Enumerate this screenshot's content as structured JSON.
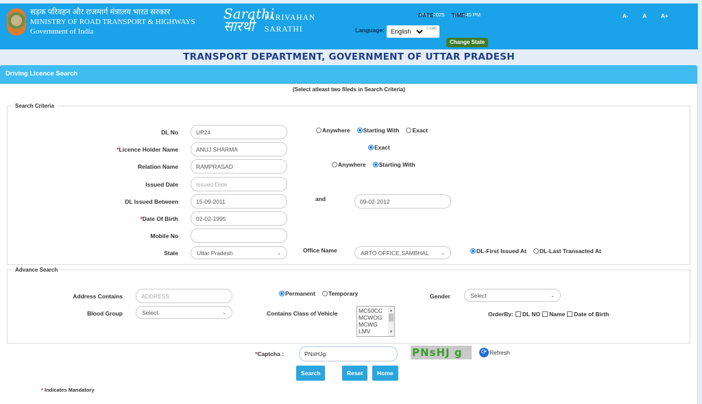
{
  "header": {
    "ministry_hindi": "सड़क परिवहन और राजमार्ग मंत्रालय भारत सरकार",
    "ministry_english": "MINISTRY OF ROAD TRANSPORT & HIGHWAYS",
    "government": "Government of India",
    "logo_top": "Sarathi",
    "logo_bottom": "सारथी",
    "brand_line1": "PARIVAHAN",
    "brand_line2": "SARATHI",
    "date_label": "DATE:",
    "date_value": "08-02-2025",
    "time_label": "TIME:",
    "time_value": "12:58:40 PM",
    "font_sizes": [
      "A-",
      "A",
      "A+"
    ],
    "language_label": "Language:",
    "language_value": "English",
    "cdac_label": "C-DAC",
    "change_state": "Change State"
  },
  "department_title": "TRANSPORT DEPARTMENT, GOVERNMENT OF UTTAR PRADESH",
  "panel": {
    "title": "Driving Licence Search",
    "note": "(Select atleast two fileds in Search Criteria)"
  },
  "search_criteria": {
    "legend": "Search Criteria",
    "dl_no": {
      "label": "DL No",
      "value": "UP24"
    },
    "dl_no_match": {
      "options": [
        "Anywhere",
        "Starting With",
        "Exact"
      ],
      "selected": "Starting With"
    },
    "holder_name": {
      "required": "*",
      "label": "Licence Holder Name",
      "value": "ANUJ SHARMA"
    },
    "holder_match": {
      "options": [
        "Exact"
      ],
      "selected": "Exact"
    },
    "relation_name": {
      "label": "Relation Name",
      "value": "RAMPRASAD"
    },
    "relation_match": {
      "options": [
        "Anywhere",
        "Starting With"
      ],
      "selected": "Starting With"
    },
    "issued_date": {
      "label": "Issued Date",
      "placeholder": "Issued Date"
    },
    "dl_issued_between": {
      "label": "DL Issued Between",
      "from": "15-09-2011",
      "and_label": "and",
      "to": "09-02-2012"
    },
    "dob": {
      "required": "*",
      "label": "Date Of Birth",
      "value": "02-02-1995"
    },
    "mobile": {
      "label": "Mobile No",
      "value": ""
    },
    "state": {
      "label": "State",
      "value": "Uttar Pradesh"
    },
    "office": {
      "label": "Office Name",
      "value": "ARTO OFFICE,SAMBHAL"
    },
    "office_match": {
      "options": [
        "DL-First Issued At",
        "DL-Last Transacted At"
      ],
      "selected": "DL-First Issued At"
    }
  },
  "advance_search": {
    "legend": "Advance Search",
    "address": {
      "label": "Address Contains",
      "placeholder": "ADDRESS"
    },
    "address_type": {
      "options": [
        "Permanent",
        "Temporary"
      ],
      "selected": "Permanent"
    },
    "gender": {
      "label": "Gender",
      "value": "Select"
    },
    "blood_group": {
      "label": "Blood Group",
      "value": "Select"
    },
    "cov": {
      "label": "Contains Class of Vehicle",
      "options": [
        "MC50CC",
        "MCWOG",
        "MCWG",
        "LMV"
      ]
    },
    "order_by": {
      "label": "OrderBy:",
      "options": [
        "DL NO",
        "Name",
        "Date of Birth"
      ]
    }
  },
  "captcha": {
    "required": "*",
    "label": "Captcha :",
    "value": "PNsHJg",
    "image_text": "PNsHJ g",
    "refresh": "Refresh"
  },
  "buttons": {
    "search": "Search",
    "reset": "Reset",
    "home": "Home"
  },
  "mandatory_note": {
    "star": "*",
    "text": " Indicates Mandatory"
  }
}
